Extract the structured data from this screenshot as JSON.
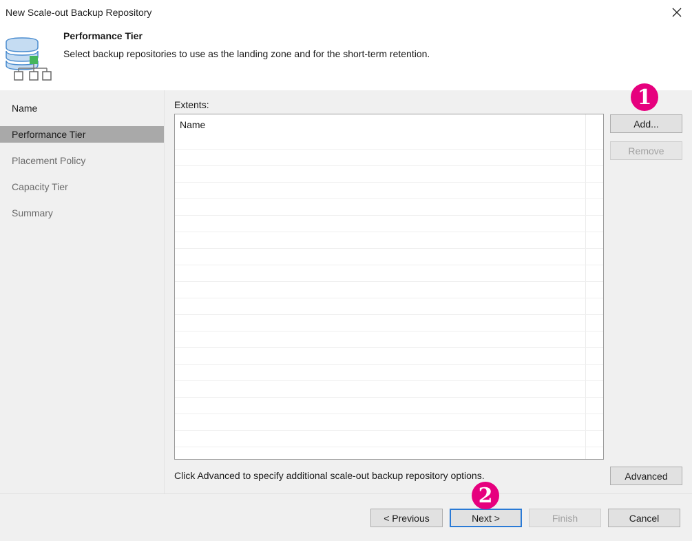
{
  "window": {
    "title": "New Scale-out Backup Repository"
  },
  "header": {
    "title": "Performance Tier",
    "description": "Select backup repositories to use as the landing zone and for the short-term retention.",
    "icon": "database-network-icon"
  },
  "sidebar": {
    "items": [
      {
        "label": "Name",
        "state": "done"
      },
      {
        "label": "Performance Tier",
        "state": "active"
      },
      {
        "label": "Placement Policy",
        "state": "pending"
      },
      {
        "label": "Capacity Tier",
        "state": "pending"
      },
      {
        "label": "Summary",
        "state": "pending"
      }
    ]
  },
  "extents": {
    "label": "Extents:",
    "column_header": "Name",
    "rows": []
  },
  "side_buttons": {
    "add": "Add...",
    "remove": "Remove",
    "advanced": "Advanced"
  },
  "hint": "Click Advanced to specify additional scale-out backup repository options.",
  "footer": {
    "previous": "< Previous",
    "next": "Next >",
    "finish": "Finish",
    "cancel": "Cancel"
  },
  "annotations": [
    {
      "number": "1"
    },
    {
      "number": "2"
    }
  ],
  "colors": {
    "active_nav": "#a9a9a9",
    "badge": "#e6007e",
    "default_button_border": "#2a7ad6"
  }
}
